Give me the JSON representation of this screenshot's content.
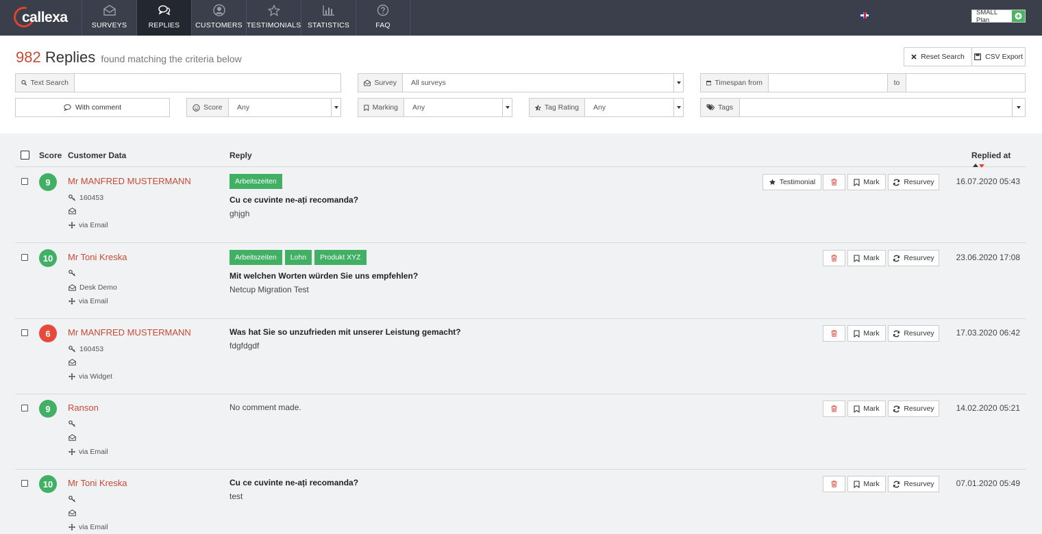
{
  "brand": {
    "name": "callexa"
  },
  "nav": [
    {
      "label": "SURVEYS",
      "icon": "envelope-open-icon",
      "active": false
    },
    {
      "label": "REPLIES",
      "icon": "comments-icon",
      "active": true
    },
    {
      "label": "CUSTOMERS",
      "icon": "user-circle-icon",
      "active": false
    },
    {
      "label": "TESTIMONIALS",
      "icon": "star-icon",
      "active": false
    },
    {
      "label": "STATISTICS",
      "icon": "bar-chart-icon",
      "active": false
    },
    {
      "label": "FAQ",
      "icon": "question-circle-icon",
      "active": false
    }
  ],
  "plan": {
    "label": "SMALL Plan"
  },
  "header": {
    "count": "982",
    "title": "Replies",
    "subtitle": "found matching the criteria below"
  },
  "actions": {
    "reset": "Reset Search",
    "export": "CSV Export"
  },
  "filters": {
    "text_search": {
      "label": "Text Search",
      "value": ""
    },
    "survey": {
      "label": "Survey",
      "value": "All surveys"
    },
    "timespan": {
      "label": "Timespan from",
      "to": "to",
      "from_value": "",
      "to_value": ""
    },
    "with_comment": "With comment",
    "score": {
      "label": "Score",
      "value": "Any"
    },
    "marking": {
      "label": "Marking",
      "value": "Any"
    },
    "tag_rating": {
      "label": "Tag Rating",
      "value": "Any"
    },
    "tags": {
      "label": "Tags",
      "value": ""
    }
  },
  "table": {
    "headers": {
      "score": "Score",
      "customer": "Customer Data",
      "reply": "Reply",
      "replied_at": "Replied at"
    },
    "buttons": {
      "testimonial": "Testimonial",
      "mark": "Mark",
      "resurvey": "Resurvey"
    },
    "rows": [
      {
        "score": "9",
        "score_color": "#41b065",
        "name": "Mr MANFRED MUSTERMANN",
        "customer_id": "160453",
        "company": "",
        "channel": "via Email",
        "tags": [
          "Arbeitszeiten"
        ],
        "question": "Cu ce cuvinte ne-ați recomanda?",
        "answer": "ghjgh",
        "date": "16.07.2020 05:43",
        "testimonial": true
      },
      {
        "score": "10",
        "score_color": "#41b065",
        "name": "Mr Toni Kreska",
        "customer_id": "",
        "company": "Desk Demo",
        "channel": "via Email",
        "tags": [
          "Arbeitszeiten",
          "Lohn",
          "Produkt XYZ"
        ],
        "question": "Mit welchen Worten würden Sie uns empfehlen?",
        "answer": "Netcup Migration Test",
        "date": "23.06.2020 17:08",
        "testimonial": false
      },
      {
        "score": "6",
        "score_color": "#e74a3b",
        "name": "Mr MANFRED MUSTERMANN",
        "customer_id": "160453",
        "company": "",
        "channel": "via Widget",
        "tags": [],
        "question": "Was hat Sie so unzufrieden mit unserer Leistung gemacht?",
        "answer": "fdgfdgdf",
        "date": "17.03.2020 06:42",
        "testimonial": false
      },
      {
        "score": "9",
        "score_color": "#41b065",
        "name": "Ranson",
        "customer_id": "",
        "company": "",
        "channel": "via Email",
        "tags": [],
        "question": "",
        "answer": "No comment made.",
        "date": "14.02.2020 05:21",
        "testimonial": false
      },
      {
        "score": "10",
        "score_color": "#41b065",
        "name": "Mr Toni Kreska",
        "customer_id": "",
        "company": "",
        "channel": "via Email",
        "tags": [],
        "question": "Cu ce cuvinte ne-ați recomanda?",
        "answer": "test",
        "date": "07.01.2020 05:49",
        "testimonial": false
      }
    ]
  }
}
